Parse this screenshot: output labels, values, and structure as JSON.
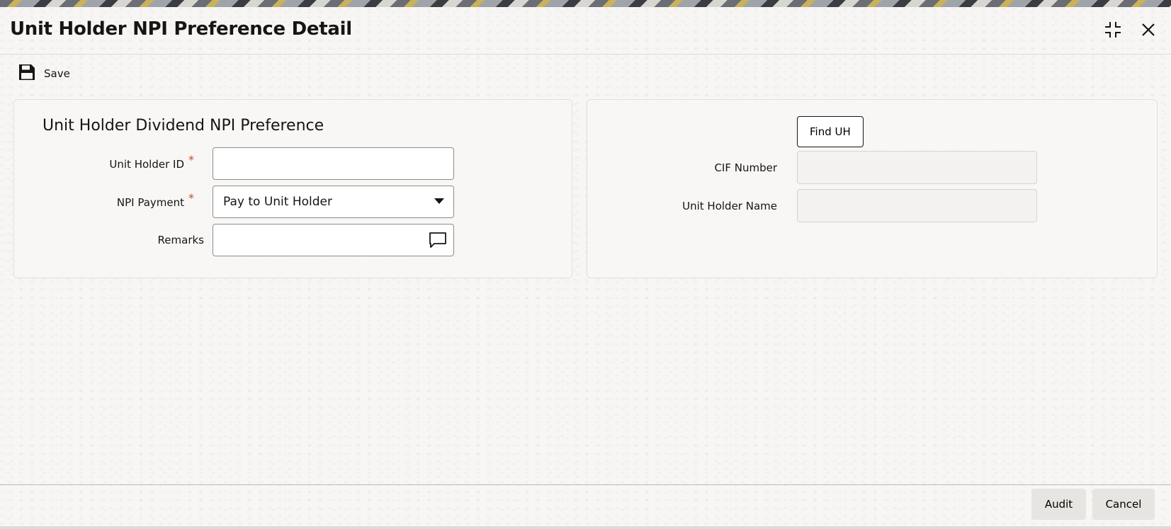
{
  "window": {
    "title": "Unit Holder NPI Preference Detail"
  },
  "toolbar": {
    "save_label": "Save"
  },
  "left_panel": {
    "section_title": "Unit Holder Dividend NPI Preference",
    "unit_holder_id": {
      "label": "Unit Holder ID",
      "required_mark": "*",
      "value": ""
    },
    "npi_payment": {
      "label": "NPI Payment",
      "required_mark": "*",
      "value": "Pay to Unit  Holder"
    },
    "remarks": {
      "label": "Remarks",
      "value": ""
    }
  },
  "right_panel": {
    "find_uh_label": "Find UH",
    "cif_number": {
      "label": "CIF Number",
      "value": ""
    },
    "unit_holder_name": {
      "label": "Unit Holder Name",
      "value": ""
    }
  },
  "footer": {
    "audit_label": "Audit",
    "cancel_label": "Cancel"
  },
  "icons": {
    "save": "floppy-disk-icon",
    "maximize": "maximize-icon",
    "close": "close-icon",
    "remarks": "comment-icon",
    "dropdown": "chevron-down-icon"
  },
  "colors": {
    "required": "#c74634",
    "text": "#161513",
    "footer_button": "#e7e5e1"
  }
}
